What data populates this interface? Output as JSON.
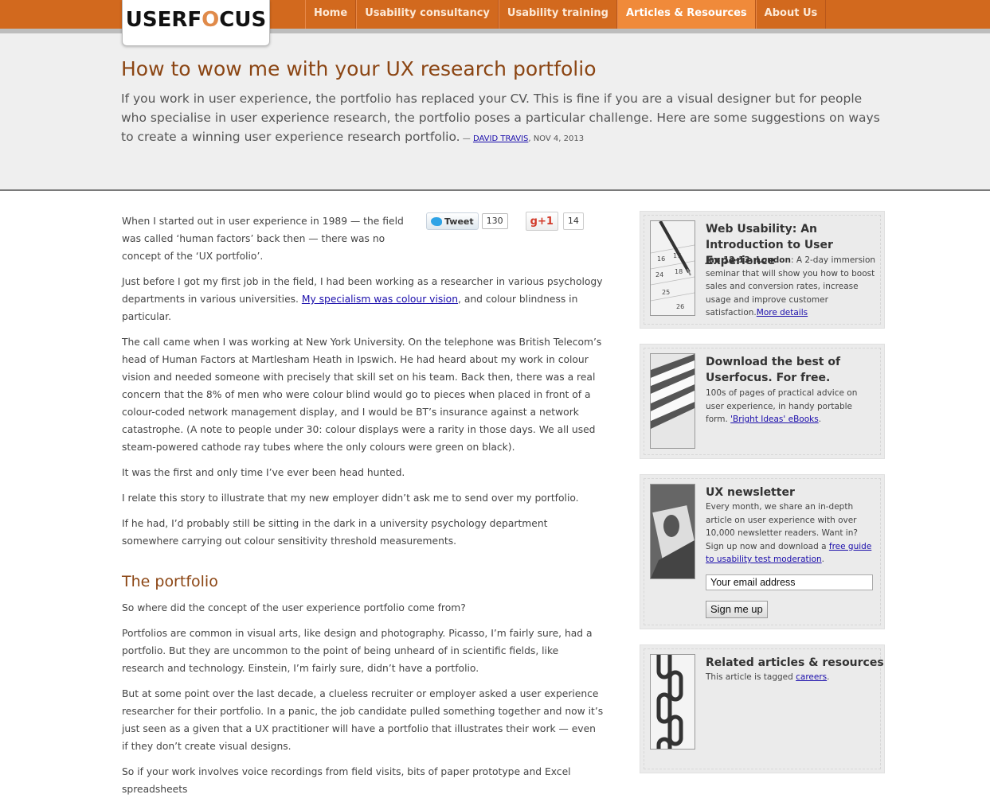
{
  "brand": {
    "logo_pre": "USERF",
    "logo_o": "O",
    "logo_post": "CUS"
  },
  "nav": {
    "items": [
      "Home",
      "Usability consultancy",
      "Usability training",
      "Articles & Resources",
      "About Us"
    ],
    "active": "Articles & Resources"
  },
  "header": {
    "title": "How to wow me with your UX research portfolio",
    "intro": "If you work in user experience, the portfolio has replaced your CV. This is fine if you are a visual designer but for people who specialise in user experience research, the portfolio poses a particular challenge. Here are some suggestions on ways to create a winning user experience research portfolio.",
    "byline_dash": " — ",
    "author": "DAVID TRAVIS",
    "date": ", NOV 4, 2013"
  },
  "share": {
    "tweet_label": "Tweet",
    "tweet_count": "130",
    "gplus_label": "g+1",
    "gplus_count": "14"
  },
  "article": {
    "p1": "When I started out in user experience in 1989 — the field was called ‘human factors’ back then — there was no concept of the ‘UX portfolio’.",
    "p2_before": "Just before I got my first job in the field, I had been working as a researcher in various psychology departments in various universities. ",
    "p2_link": "My specialism was colour vision",
    "p2_after": ", and colour blindness in particular.",
    "p3": "The call came when I was working at New York University. On the telephone was British Telecom’s head of Human Factors at Martlesham Heath in Ipswich. He had heard about my work in colour vision and needed someone with precisely that skill set on his team. Back then, there was a real concern that the 8% of men who were colour blind would go to pieces when placed in front of a colour-coded network management display, and I would be BT’s insurance against a network catastrophe. (A note to people under 30: colour displays were a rarity in those days. We all used steam-powered cathode ray tubes where the only colours were green on black).",
    "p4": "It was the first and only time I’ve ever been head hunted.",
    "p5": "I relate this story to illustrate that my new employer didn’t ask me to send over my portfolio.",
    "p6": "If he had, I’d probably still be sitting in the dark in a university psychology department somewhere carrying out colour sensitivity threshold measurements.",
    "h2": "The portfolio",
    "p7": "So where did the concept of the user experience portfolio come from?",
    "p8": "Portfolios are common in visual arts, like design and photography. Picasso, I’m fairly sure, had a portfolio. But they are uncommon to the point of being unheard of in scientific fields, like research and technology. Einstein, I’m fairly sure, didn’t have a portfolio.",
    "p9": "But at some point over the last decade, a clueless recruiter or employer asked a user experience researcher for their portfolio. In a panic, the job candidate pulled something together and now it’s just seen as a given that a UX practitioner will have a portfolio that illustrates their work — even if they don’t create visual designs.",
    "p10": "So if your work involves voice recordings from field visits, bits of paper prototype and Excel spreadsheets"
  },
  "sidebar": {
    "course": {
      "title": "Web Usability: An Introduction to User Experience",
      "date": "Jan 12-13, London",
      "text": ": A 2-day immersion seminar that will show you how to boost sales and conversion rates, increase usage and improve customer satisfaction.",
      "link": "More details"
    },
    "download": {
      "title": "Download the best of Userfocus. For free.",
      "text": "100s of pages of practical advice on user experience, in handy portable form. ",
      "link": "'Bright Ideas' eBooks",
      "after": "."
    },
    "newsletter": {
      "title": "UX newsletter",
      "text": "Every month, we share an in-depth article on user experience with over 10,000 newsletter readers. Want in? Sign up now and download a ",
      "link": "free guide to usability test moderation",
      "after": ".",
      "placeholder": "Your email address",
      "button": "Sign me up"
    },
    "related": {
      "title": "Related articles & resources",
      "text": "This article is tagged ",
      "link": "careers",
      "after": "."
    }
  },
  "colors": {
    "brand_orange": "#d2691e",
    "active_tab": "#f08a3a",
    "heading_brown": "#8b4513",
    "link": "#1a0dab"
  }
}
